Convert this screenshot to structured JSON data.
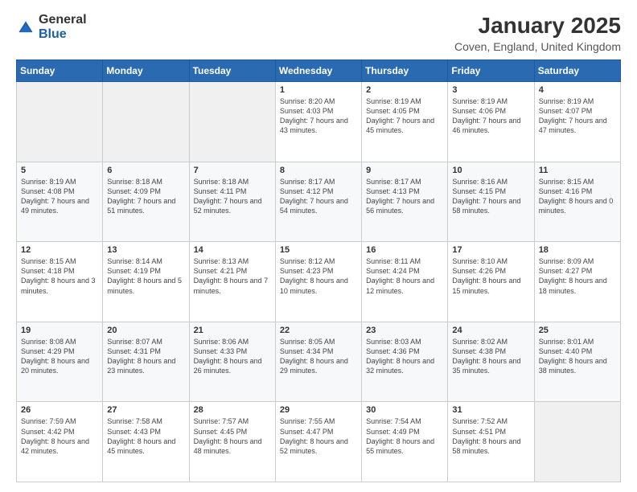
{
  "logo": {
    "general": "General",
    "blue": "Blue"
  },
  "title": "January 2025",
  "location": "Coven, England, United Kingdom",
  "days_of_week": [
    "Sunday",
    "Monday",
    "Tuesday",
    "Wednesday",
    "Thursday",
    "Friday",
    "Saturday"
  ],
  "weeks": [
    [
      {
        "day": "",
        "sunrise": "",
        "sunset": "",
        "daylight": ""
      },
      {
        "day": "",
        "sunrise": "",
        "sunset": "",
        "daylight": ""
      },
      {
        "day": "",
        "sunrise": "",
        "sunset": "",
        "daylight": ""
      },
      {
        "day": "1",
        "sunrise": "Sunrise: 8:20 AM",
        "sunset": "Sunset: 4:03 PM",
        "daylight": "Daylight: 7 hours and 43 minutes."
      },
      {
        "day": "2",
        "sunrise": "Sunrise: 8:19 AM",
        "sunset": "Sunset: 4:05 PM",
        "daylight": "Daylight: 7 hours and 45 minutes."
      },
      {
        "day": "3",
        "sunrise": "Sunrise: 8:19 AM",
        "sunset": "Sunset: 4:06 PM",
        "daylight": "Daylight: 7 hours and 46 minutes."
      },
      {
        "day": "4",
        "sunrise": "Sunrise: 8:19 AM",
        "sunset": "Sunset: 4:07 PM",
        "daylight": "Daylight: 7 hours and 47 minutes."
      }
    ],
    [
      {
        "day": "5",
        "sunrise": "Sunrise: 8:19 AM",
        "sunset": "Sunset: 4:08 PM",
        "daylight": "Daylight: 7 hours and 49 minutes."
      },
      {
        "day": "6",
        "sunrise": "Sunrise: 8:18 AM",
        "sunset": "Sunset: 4:09 PM",
        "daylight": "Daylight: 7 hours and 51 minutes."
      },
      {
        "day": "7",
        "sunrise": "Sunrise: 8:18 AM",
        "sunset": "Sunset: 4:11 PM",
        "daylight": "Daylight: 7 hours and 52 minutes."
      },
      {
        "day": "8",
        "sunrise": "Sunrise: 8:17 AM",
        "sunset": "Sunset: 4:12 PM",
        "daylight": "Daylight: 7 hours and 54 minutes."
      },
      {
        "day": "9",
        "sunrise": "Sunrise: 8:17 AM",
        "sunset": "Sunset: 4:13 PM",
        "daylight": "Daylight: 7 hours and 56 minutes."
      },
      {
        "day": "10",
        "sunrise": "Sunrise: 8:16 AM",
        "sunset": "Sunset: 4:15 PM",
        "daylight": "Daylight: 7 hours and 58 minutes."
      },
      {
        "day": "11",
        "sunrise": "Sunrise: 8:15 AM",
        "sunset": "Sunset: 4:16 PM",
        "daylight": "Daylight: 8 hours and 0 minutes."
      }
    ],
    [
      {
        "day": "12",
        "sunrise": "Sunrise: 8:15 AM",
        "sunset": "Sunset: 4:18 PM",
        "daylight": "Daylight: 8 hours and 3 minutes."
      },
      {
        "day": "13",
        "sunrise": "Sunrise: 8:14 AM",
        "sunset": "Sunset: 4:19 PM",
        "daylight": "Daylight: 8 hours and 5 minutes."
      },
      {
        "day": "14",
        "sunrise": "Sunrise: 8:13 AM",
        "sunset": "Sunset: 4:21 PM",
        "daylight": "Daylight: 8 hours and 7 minutes."
      },
      {
        "day": "15",
        "sunrise": "Sunrise: 8:12 AM",
        "sunset": "Sunset: 4:23 PM",
        "daylight": "Daylight: 8 hours and 10 minutes."
      },
      {
        "day": "16",
        "sunrise": "Sunrise: 8:11 AM",
        "sunset": "Sunset: 4:24 PM",
        "daylight": "Daylight: 8 hours and 12 minutes."
      },
      {
        "day": "17",
        "sunrise": "Sunrise: 8:10 AM",
        "sunset": "Sunset: 4:26 PM",
        "daylight": "Daylight: 8 hours and 15 minutes."
      },
      {
        "day": "18",
        "sunrise": "Sunrise: 8:09 AM",
        "sunset": "Sunset: 4:27 PM",
        "daylight": "Daylight: 8 hours and 18 minutes."
      }
    ],
    [
      {
        "day": "19",
        "sunrise": "Sunrise: 8:08 AM",
        "sunset": "Sunset: 4:29 PM",
        "daylight": "Daylight: 8 hours and 20 minutes."
      },
      {
        "day": "20",
        "sunrise": "Sunrise: 8:07 AM",
        "sunset": "Sunset: 4:31 PM",
        "daylight": "Daylight: 8 hours and 23 minutes."
      },
      {
        "day": "21",
        "sunrise": "Sunrise: 8:06 AM",
        "sunset": "Sunset: 4:33 PM",
        "daylight": "Daylight: 8 hours and 26 minutes."
      },
      {
        "day": "22",
        "sunrise": "Sunrise: 8:05 AM",
        "sunset": "Sunset: 4:34 PM",
        "daylight": "Daylight: 8 hours and 29 minutes."
      },
      {
        "day": "23",
        "sunrise": "Sunrise: 8:03 AM",
        "sunset": "Sunset: 4:36 PM",
        "daylight": "Daylight: 8 hours and 32 minutes."
      },
      {
        "day": "24",
        "sunrise": "Sunrise: 8:02 AM",
        "sunset": "Sunset: 4:38 PM",
        "daylight": "Daylight: 8 hours and 35 minutes."
      },
      {
        "day": "25",
        "sunrise": "Sunrise: 8:01 AM",
        "sunset": "Sunset: 4:40 PM",
        "daylight": "Daylight: 8 hours and 38 minutes."
      }
    ],
    [
      {
        "day": "26",
        "sunrise": "Sunrise: 7:59 AM",
        "sunset": "Sunset: 4:42 PM",
        "daylight": "Daylight: 8 hours and 42 minutes."
      },
      {
        "day": "27",
        "sunrise": "Sunrise: 7:58 AM",
        "sunset": "Sunset: 4:43 PM",
        "daylight": "Daylight: 8 hours and 45 minutes."
      },
      {
        "day": "28",
        "sunrise": "Sunrise: 7:57 AM",
        "sunset": "Sunset: 4:45 PM",
        "daylight": "Daylight: 8 hours and 48 minutes."
      },
      {
        "day": "29",
        "sunrise": "Sunrise: 7:55 AM",
        "sunset": "Sunset: 4:47 PM",
        "daylight": "Daylight: 8 hours and 52 minutes."
      },
      {
        "day": "30",
        "sunrise": "Sunrise: 7:54 AM",
        "sunset": "Sunset: 4:49 PM",
        "daylight": "Daylight: 8 hours and 55 minutes."
      },
      {
        "day": "31",
        "sunrise": "Sunrise: 7:52 AM",
        "sunset": "Sunset: 4:51 PM",
        "daylight": "Daylight: 8 hours and 58 minutes."
      },
      {
        "day": "",
        "sunrise": "",
        "sunset": "",
        "daylight": ""
      }
    ]
  ]
}
